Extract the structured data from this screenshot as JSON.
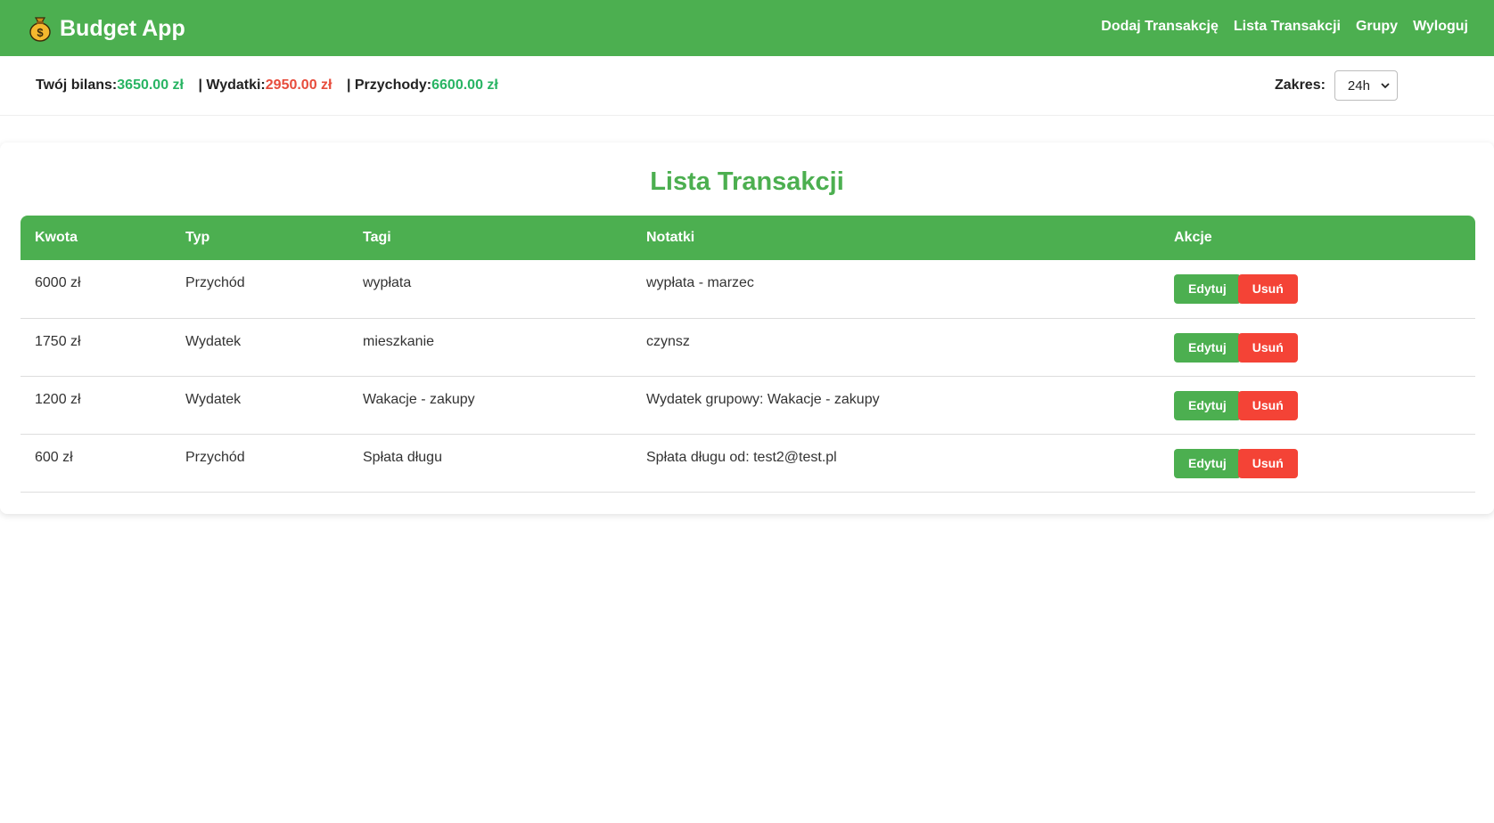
{
  "navbar": {
    "brand_icon": "money-bag-icon",
    "title": "Budget App",
    "links": [
      {
        "label": "Dodaj Transakcję"
      },
      {
        "label": "Lista Transakcji"
      },
      {
        "label": "Grupy"
      },
      {
        "label": "Wyloguj"
      }
    ]
  },
  "summary": {
    "balance_label": "Twój bilans:",
    "balance_value": "3650.00 zł",
    "expenses_label": "| Wydatki:",
    "expenses_value": "2950.00 zł",
    "income_label": "| Przychody:",
    "income_value": "6600.00 zł"
  },
  "range": {
    "label": "Zakres:",
    "selected": "24h"
  },
  "main": {
    "title": "Lista Transakcji",
    "table": {
      "headers": [
        "Kwota",
        "Typ",
        "Tagi",
        "Notatki",
        "Akcje"
      ],
      "rows": [
        {
          "amount": "6000 zł",
          "type": "Przychód",
          "tags": "wypłata",
          "notes": "wypłata - marzec"
        },
        {
          "amount": "1750 zł",
          "type": "Wydatek",
          "tags": "mieszkanie",
          "notes": "czynsz"
        },
        {
          "amount": "1200 zł",
          "type": "Wydatek",
          "tags": "Wakacje - zakupy",
          "notes": "Wydatek grupowy: Wakacje - zakupy"
        },
        {
          "amount": "600 zł",
          "type": "Przychód",
          "tags": "Spłata długu",
          "notes": "Spłata długu od: test2@test.pl"
        }
      ],
      "edit_label": "Edytuj",
      "delete_label": "Usuń"
    }
  },
  "colors": {
    "primary": "#4caf50",
    "positive": "#28b463",
    "negative": "#e74c3c",
    "danger_button": "#f44336"
  }
}
